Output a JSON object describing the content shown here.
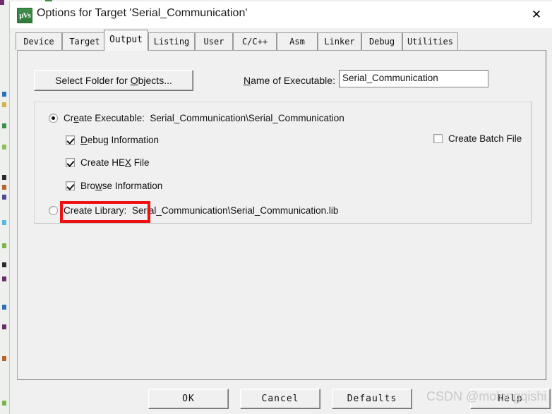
{
  "window": {
    "title": "Options for Target 'Serial_Communication'",
    "app_icon_label": "µVs",
    "close_label": "✕"
  },
  "tabs": [
    {
      "label": "Device",
      "selected": false
    },
    {
      "label": "Target",
      "selected": false
    },
    {
      "label": "Output",
      "selected": true
    },
    {
      "label": "Listing",
      "selected": false
    },
    {
      "label": "User",
      "selected": false
    },
    {
      "label": "C/C++",
      "selected": false
    },
    {
      "label": "Asm",
      "selected": false
    },
    {
      "label": "Linker",
      "selected": false
    },
    {
      "label": "Debug",
      "selected": false
    },
    {
      "label": "Utilities",
      "selected": false
    }
  ],
  "output_page": {
    "select_folder_button": "Select Folder for Objects...",
    "executable_label": "Name of Executable:",
    "executable_value": "Serial_Communication",
    "create_executable": {
      "label": "Create Executable:",
      "path": "Serial_Communication\\Serial_Communication",
      "selected": true
    },
    "debug_information": {
      "label": "Debug Information",
      "checked": true
    },
    "create_hex_file": {
      "label": "Create HEX File",
      "checked": true
    },
    "browse_information": {
      "label": "Browse Information",
      "checked": true
    },
    "create_batch_file": {
      "label": "Create Batch File",
      "checked": false
    },
    "create_library": {
      "label": "Create Library:",
      "path": "Serial_Communication\\Serial_Communication.lib",
      "selected": false
    },
    "highlight_color": "#ee1111"
  },
  "footer": {
    "ok": "OK",
    "cancel": "Cancel",
    "defaults": "Defaults",
    "help": "Help"
  },
  "watermark": "CSDN @molongqishi"
}
